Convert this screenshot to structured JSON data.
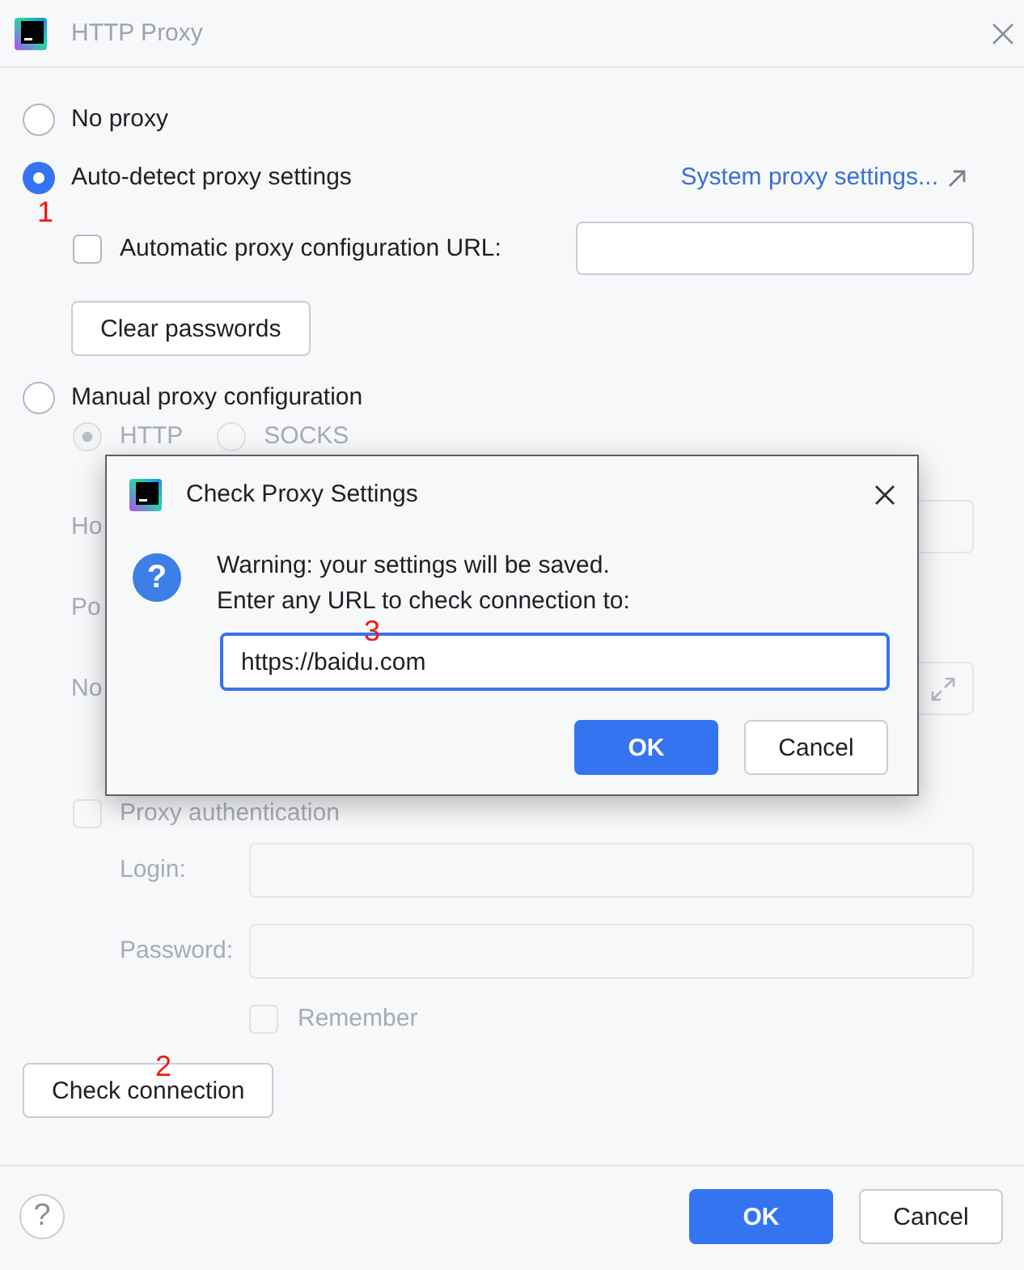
{
  "window": {
    "title": "HTTP Proxy"
  },
  "proxy_modes": [
    {
      "label": "No proxy",
      "selected": false
    },
    {
      "label": "Auto-detect proxy settings",
      "selected": true,
      "callout": "1"
    },
    {
      "label": "Manual proxy configuration",
      "selected": false
    }
  ],
  "system_proxy_link": "System proxy settings...",
  "auto_config": {
    "label": "Automatic proxy configuration URL:",
    "checked": false
  },
  "clear_passwords_button": "Clear passwords",
  "manual": {
    "disabled": true,
    "protocols": [
      {
        "label": "HTTP",
        "selected": true
      },
      {
        "label": "SOCKS",
        "selected": false
      }
    ],
    "fields": [
      {
        "label": "Ho",
        "kind": "field"
      },
      {
        "label": "Po",
        "kind": "plain"
      },
      {
        "label": "No",
        "kind": "expandable"
      }
    ]
  },
  "proxy_auth": {
    "label": "Proxy authentication",
    "checked": false,
    "disabled": true,
    "fields": [
      {
        "label": "Login:"
      },
      {
        "label": "Password:"
      }
    ],
    "remember": {
      "label": "Remember",
      "checked": false
    }
  },
  "check_connection_button": {
    "label": "Check connection",
    "callout": "2"
  },
  "footer": {
    "help": "?",
    "buttons": [
      {
        "label": "OK",
        "kind": "primary"
      },
      {
        "label": "Cancel",
        "kind": "secondary"
      }
    ]
  },
  "modal": {
    "title": "Check Proxy Settings",
    "icon_glyph": "?",
    "message": [
      "Warning: your settings will be saved.",
      "Enter any URL to check connection to:"
    ],
    "url_field": {
      "value": "https://baidu.com",
      "focused": true,
      "callout": "3"
    },
    "buttons": [
      {
        "label": "OK",
        "kind": "primary"
      },
      {
        "label": "Cancel",
        "kind": "secondary"
      }
    ]
  }
}
